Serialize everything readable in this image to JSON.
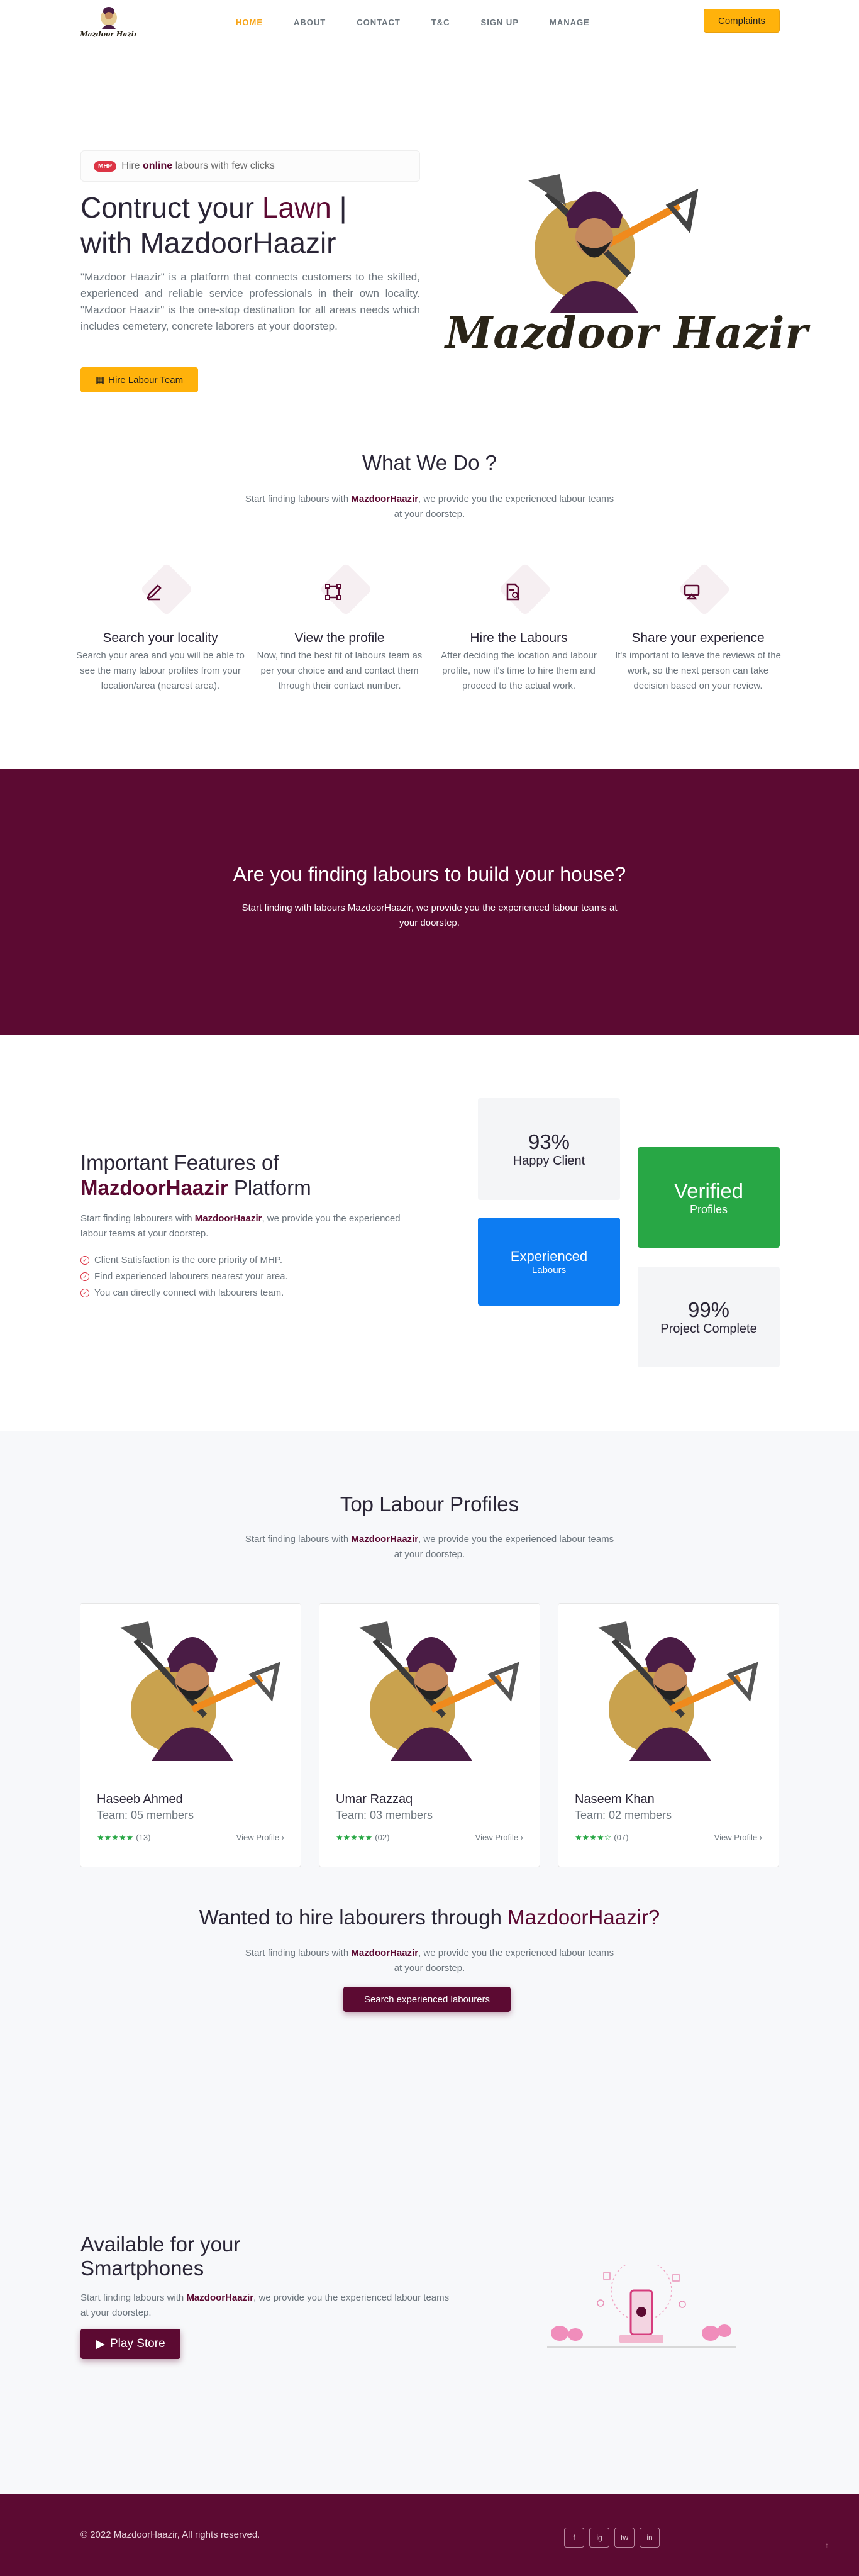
{
  "nav": {
    "logo_text": "Mazdoor Hazir",
    "items": [
      "HOME",
      "ABOUT",
      "CONTACT",
      "T&C",
      "SIGN UP",
      "MANAGE"
    ],
    "complaints": "Complaints"
  },
  "hero": {
    "badge": "MHP",
    "pill_pre": "Hire",
    "pill_bold": "online",
    "pill_post": "labours with few clicks",
    "title_pre": "Contruct your",
    "title_highlight": "Lawn",
    "title_post": "|",
    "title_line2": "with MazdoorHaazir",
    "description": "\"Mazdoor Haazir\" is a platform that connects customers to the skilled, experienced and reliable service professionals in their own locality. \"Mazdoor Haazir\" is the one-stop destination for all areas needs which includes cemetery, concrete laborers at your doorstep.",
    "cta": "Hire Labour Team",
    "brand": "Mazdoor Hazir"
  },
  "whatwedo": {
    "title": "What We Do ?",
    "sub_pre": "Start finding labours with",
    "sub_bold": "MazdoorHaazir",
    "sub_post": ", we provide you the experienced labour teams at your doorstep.",
    "features": [
      {
        "title": "Search your locality",
        "text": "Search your area and you will be able to see the many labour profiles from your location/area (nearest area)."
      },
      {
        "title": "View the profile",
        "text": "Now, find the best fit of labours team as per your choice and and contact them through their contact number."
      },
      {
        "title": "Hire the Labours",
        "text": "After deciding the location and labour profile, now it's time to hire them and proceed to the actual work."
      },
      {
        "title": "Share your experience",
        "text": "It's important to leave the reviews of the work, so the next person can take decision based on your review."
      }
    ]
  },
  "banner": {
    "title": "Are you finding labours to build your house?",
    "text": "Start finding with labours MazdoorHaazir, we provide you the experienced labour teams at your doorstep."
  },
  "important": {
    "title_line1": "Important Features of",
    "title_bold": "MazdoorHaazir",
    "title_post": "Platform",
    "lead_pre": "Start finding labourers with",
    "lead_bold": "MazdoorHaazir",
    "lead_post": ", we provide you the experienced labour teams at your doorstep.",
    "points": [
      "Client Satisfaction is the core priority of MHP.",
      "Find experienced labourers nearest your area.",
      "You can directly connect with labourers team."
    ],
    "stats": {
      "happy_num": "93%",
      "happy_lbl": "Happy Client",
      "verified_num": "Verified",
      "verified_lbl": "Profiles",
      "exp_num": "Experienced",
      "exp_lbl": "Labours",
      "complete_num": "99%",
      "complete_lbl": "Project Complete"
    }
  },
  "profiles": {
    "title": "Top Labour Profiles",
    "sub_pre": "Start finding labours with",
    "sub_bold": "MazdoorHaazir",
    "sub_post": ", we provide you the experienced labour teams at your doorstep.",
    "cards": [
      {
        "name": "Haseeb Ahmed",
        "team": "Team: 05 members",
        "stars": "★★★★★",
        "rating": 5,
        "reviews": "(13)",
        "view": "View Profile ›"
      },
      {
        "name": "Umar Razzaq",
        "team": "Team: 03 members",
        "stars": "★★★★★",
        "rating": 5,
        "reviews": "(02)",
        "view": "View Profile ›"
      },
      {
        "name": "Naseem Khan",
        "team": "Team: 02 members",
        "stars": "★★★★☆",
        "rating": 4,
        "reviews": "(07)",
        "view": "View Profile ›"
      }
    ]
  },
  "hire": {
    "title_pre": "Wanted to hire labourers through",
    "title_bold": "MazdoorHaazir?",
    "sub_pre": "Start finding labours with",
    "sub_bold": "MazdoorHaazir",
    "sub_post": ", we provide you the experienced labour teams at your doorstep.",
    "cta": "Search experienced labourers"
  },
  "app": {
    "title": "Available for your Smartphones",
    "lead_pre": "Start finding labours with",
    "lead_bold": "MazdoorHaazir",
    "lead_post": ", we provide you the experienced labour teams at your doorstep.",
    "cta": "Play Store"
  },
  "footer": {
    "copyright": "© 2022 MazdoorHaazir, All rights reserved.",
    "social": [
      "f",
      "ig",
      "tw",
      "in"
    ],
    "totop": "↑"
  },
  "colors": {
    "brand": "#5c0a32",
    "accent": "#ffb20b",
    "green": "#28a745",
    "blue": "#0d7cf2"
  }
}
